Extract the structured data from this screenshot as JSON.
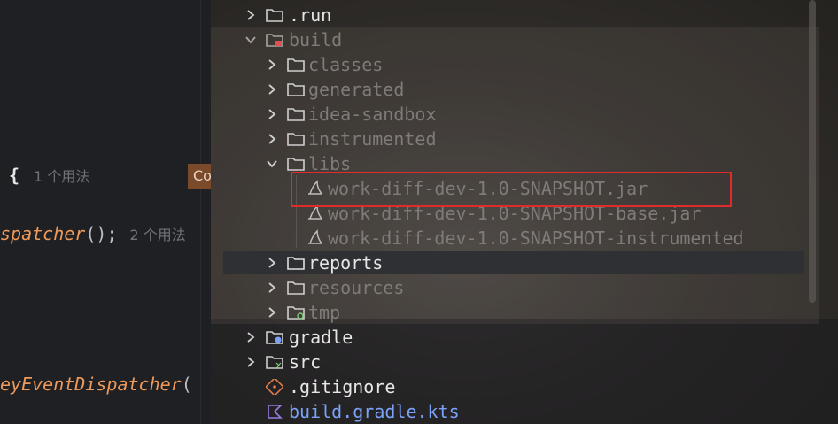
{
  "editor": {
    "brace": "{",
    "brace_hint": "1 个用法",
    "badge": "Co",
    "dispatch_fn": "spatcher",
    "dispatch_punc": "();",
    "dispatch_hint": "2 个用法",
    "key_fn": "eyEventDispatcher",
    "key_punc": "("
  },
  "tree": {
    "rows": [
      {
        "label": ".run"
      },
      {
        "label": "build"
      },
      {
        "label": "classes"
      },
      {
        "label": "generated"
      },
      {
        "label": "idea-sandbox"
      },
      {
        "label": "instrumented"
      },
      {
        "label": "libs"
      },
      {
        "label": "work-diff-dev-1.0-SNAPSHOT.jar"
      },
      {
        "label": "work-diff-dev-1.0-SNAPSHOT-base.jar"
      },
      {
        "label": "work-diff-dev-1.0-SNAPSHOT-instrumented"
      },
      {
        "label": "reports"
      },
      {
        "label": "resources"
      },
      {
        "label": "tmp"
      },
      {
        "label": "gradle"
      },
      {
        "label": "src"
      },
      {
        "label": ".gitignore"
      },
      {
        "label": "build.gradle.kts"
      }
    ]
  },
  "colors": {
    "highlight_border": "#e02b2b",
    "selection": "#2e3033",
    "function_orange": "#ef9a5a",
    "link_blue": "#7aa2f7"
  },
  "icons": {
    "chevron_right": "chevron-right-icon",
    "chevron_down": "chevron-down-icon",
    "folder": "folder-icon",
    "build_folder": "excluded-folder-icon",
    "jar": "jar-icon",
    "gitignore": "git-icon",
    "kotlin": "kotlin-icon"
  }
}
